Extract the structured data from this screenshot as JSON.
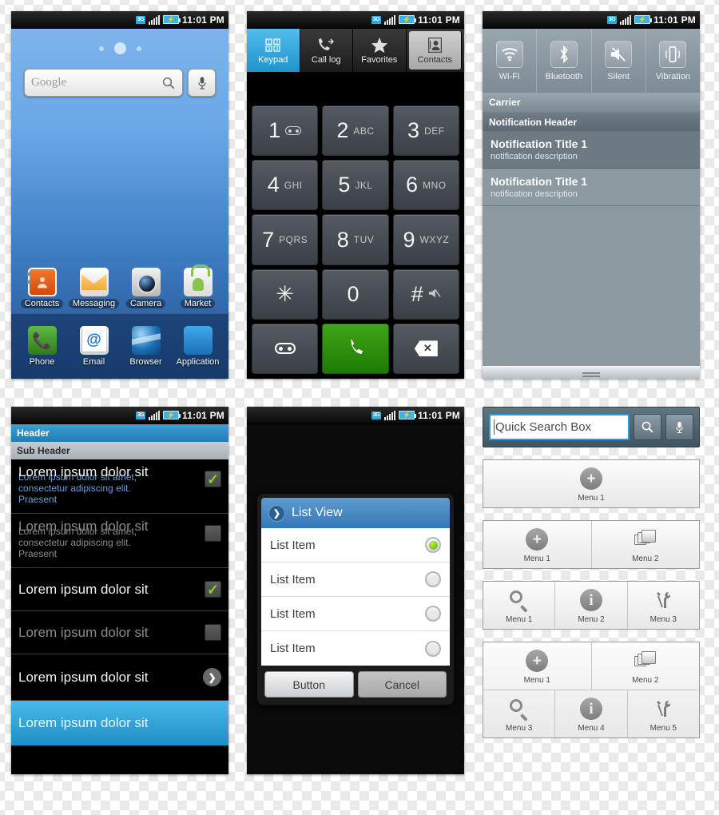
{
  "statusbar": {
    "network": "3G",
    "time": "11:01 PM",
    "battery_icon": "battery-charging-icon",
    "signal_icon": "signal-bars-icon"
  },
  "home": {
    "search_placeholder": "Google",
    "search_icon": "magnifier-icon",
    "mic_icon": "microphone-icon",
    "page_dots": 3,
    "apps": [
      {
        "label": "Contacts",
        "icon": "contacts-icon"
      },
      {
        "label": "Messaging",
        "icon": "envelope-icon"
      },
      {
        "label": "Camera",
        "icon": "camera-icon"
      },
      {
        "label": "Market",
        "icon": "market-bag-icon"
      }
    ],
    "dock": [
      {
        "label": "Phone",
        "icon": "phone-handset-icon"
      },
      {
        "label": "Email",
        "icon": "email-at-icon"
      },
      {
        "label": "Browser",
        "icon": "globe-icon"
      },
      {
        "label": "Application",
        "icon": "app-grid-icon"
      }
    ]
  },
  "dialer": {
    "tabs": [
      {
        "label": "Keypad",
        "icon": "keypad-icon",
        "active": true
      },
      {
        "label": "Call log",
        "icon": "call-log-icon",
        "active": false
      },
      {
        "label": "Favorites",
        "icon": "star-icon",
        "active": false
      },
      {
        "label": "Contacts",
        "icon": "contact-card-icon",
        "active": false
      }
    ],
    "keys": [
      {
        "num": "1",
        "sub": "",
        "icon": "voicemail-icon"
      },
      {
        "num": "2",
        "sub": "ABC"
      },
      {
        "num": "3",
        "sub": "DEF"
      },
      {
        "num": "4",
        "sub": "GHI"
      },
      {
        "num": "5",
        "sub": "JKL"
      },
      {
        "num": "6",
        "sub": "MNO"
      },
      {
        "num": "7",
        "sub": "PQRS"
      },
      {
        "num": "8",
        "sub": "TUV"
      },
      {
        "num": "9",
        "sub": "WXYZ"
      },
      {
        "num": "✳",
        "sub": ""
      },
      {
        "num": "0",
        "sub": "+"
      },
      {
        "num": "#",
        "sub": "",
        "icon": "mute-icon"
      }
    ],
    "actions": [
      {
        "name": "voicemail-button",
        "icon": "voicemail-icon"
      },
      {
        "name": "call-button",
        "icon": "phone-handset-icon"
      },
      {
        "name": "backspace-button",
        "icon": "backspace-icon",
        "glyph": "✕"
      }
    ]
  },
  "notifications": {
    "toggles": [
      {
        "label": "Wi-Fi",
        "icon": "wifi-icon"
      },
      {
        "label": "Bluetooth",
        "icon": "bluetooth-icon"
      },
      {
        "label": "Silent",
        "icon": "mute-speaker-icon"
      },
      {
        "label": "Vibration",
        "icon": "vibration-icon"
      }
    ],
    "carrier_label": "Carrier",
    "header_label": "Notification Header",
    "items": [
      {
        "title": "Notification Title 1",
        "description": "notification description"
      },
      {
        "title": "Notification Title 1",
        "description": "notification description"
      }
    ]
  },
  "listscreen": {
    "header": "Header",
    "sub_header": "Sub Header",
    "rows": [
      {
        "title": "Lorem ipsum dolor sit",
        "sub": "Lorem ipsum dolor sit amet, consectetur adipiscing elit. Praesent",
        "control": "checkbox",
        "checked": true,
        "dim": false
      },
      {
        "title": "Lorem ipsum dolor sit",
        "sub": "Lorem ipsum dolor sit amet, consectetur adipiscing elit. Praesent",
        "control": "checkbox",
        "checked": false,
        "dim": true
      },
      {
        "title": "Lorem ipsum dolor sit",
        "sub": "",
        "control": "checkbox",
        "checked": true,
        "dim": false
      },
      {
        "title": "Lorem ipsum dolor sit",
        "sub": "",
        "control": "checkbox",
        "checked": false,
        "dim": true
      },
      {
        "title": "Lorem ipsum dolor sit",
        "sub": "",
        "control": "chevron",
        "checked": false,
        "dim": false
      },
      {
        "title": "Lorem ipsum dolor sit",
        "sub": "",
        "control": "none",
        "checked": false,
        "dim": false,
        "selected": true
      }
    ]
  },
  "dialog": {
    "title": "List View",
    "title_icon": "chevron-right-icon",
    "items": [
      {
        "label": "List Item",
        "selected": true
      },
      {
        "label": "List Item",
        "selected": false
      },
      {
        "label": "List Item",
        "selected": false
      },
      {
        "label": "List Item",
        "selected": false
      }
    ],
    "primary_button": "Button",
    "secondary_button": "Cancel"
  },
  "searchwidget": {
    "value": "Quick Search Box",
    "search_icon": "magnifier-icon",
    "mic_icon": "microphone-icon"
  },
  "menupanels": [
    {
      "rows": [
        [
          {
            "label": "Menu 1",
            "icon": "plus-circle-icon"
          }
        ]
      ]
    },
    {
      "rows": [
        [
          {
            "label": "Menu 1",
            "icon": "plus-circle-icon"
          },
          {
            "label": "Menu 2",
            "icon": "gallery-icon"
          }
        ]
      ]
    },
    {
      "rows": [
        [
          {
            "label": "Menu 1",
            "icon": "magnifier-icon"
          },
          {
            "label": "Menu 2",
            "icon": "info-circle-icon"
          },
          {
            "label": "Menu 3",
            "icon": "tools-icon"
          }
        ]
      ]
    },
    {
      "rows": [
        [
          {
            "label": "Menu 1",
            "icon": "plus-circle-icon"
          },
          {
            "label": "Menu 2",
            "icon": "gallery-icon"
          }
        ],
        [
          {
            "label": "Menu 3",
            "icon": "magnifier-icon"
          },
          {
            "label": "Menu 4",
            "icon": "info-circle-icon"
          },
          {
            "label": "Menu 5",
            "icon": "tools-icon"
          }
        ]
      ]
    }
  ],
  "colors": {
    "accent_blue": "#1e8fc4",
    "header_blue": "#3d9fd4",
    "call_green": "#2f8a0c",
    "check_green": "#8dd322"
  }
}
